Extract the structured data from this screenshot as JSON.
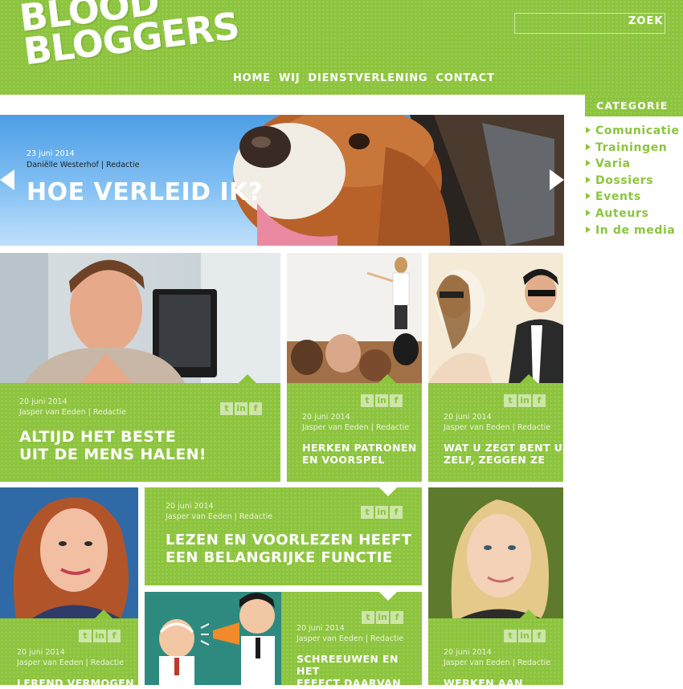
{
  "logo": {
    "line1": "BLOOD",
    "line2": "BLOGGERS"
  },
  "search": {
    "button": "ZOEK",
    "placeholder": ""
  },
  "nav": [
    "HOME",
    "WIJ",
    "DIENSTVERLENING",
    "CONTACT"
  ],
  "category": {
    "heading": "CATEGORIE",
    "items": [
      "Comunicatie",
      "Trainingen",
      "Varia",
      "Dossiers",
      "Events",
      "Auteurs",
      "In de media"
    ]
  },
  "hero": {
    "date": "23 juni 2014",
    "author": "Daniëlle Westerhof | Redactie",
    "title": "HOE VERLEID IK?"
  },
  "social": {
    "twitter": "t",
    "linkedin": "in",
    "facebook": "f"
  },
  "posts": [
    {
      "date": "20 juni 2014",
      "author": "Jasper van Eeden | Redactie",
      "title_line1": "ALTIJD HET BESTE",
      "title_line2": "UIT DE MENS HALEN!"
    },
    {
      "date": "20 juni 2014",
      "author": "Jasper van Eeden | Redactie",
      "title_line1": "HERKEN PATRONEN",
      "title_line2": "EN VOORSPEL"
    },
    {
      "date": "20 juni 2014",
      "author": "Jasper van Eeden | Redactie",
      "title_line1": "WAT U ZEGT BENT U",
      "title_line2": "ZELF, ZEGGEN ZE"
    },
    {
      "date": "20 juni 2014",
      "author": "Jasper van Eeden | Redactie",
      "title_line1": "LEZEN EN VOORLEZEN HEEFT",
      "title_line2": "EEN BELANGRIJKE FUNCTIE"
    },
    {
      "date": "20 juni 2014",
      "author": "Jasper van Eeden | Redactie",
      "title_line1": "SCHREEUWEN EN HET",
      "title_line2": "EFFECT DAARVAN"
    },
    {
      "date": "20 juni 2014",
      "author": "Jasper van Eeden | Redactie",
      "title_line1": "LEREND VERMOGEN",
      "title_line2": ""
    },
    {
      "date": "20 juni 2014",
      "author": "Jasper van Eeden | Redactie",
      "title_line1": "WERKEN AAN",
      "title_line2": ""
    }
  ],
  "colors": {
    "accent": "#8cc43d",
    "white": "#ffffff"
  }
}
